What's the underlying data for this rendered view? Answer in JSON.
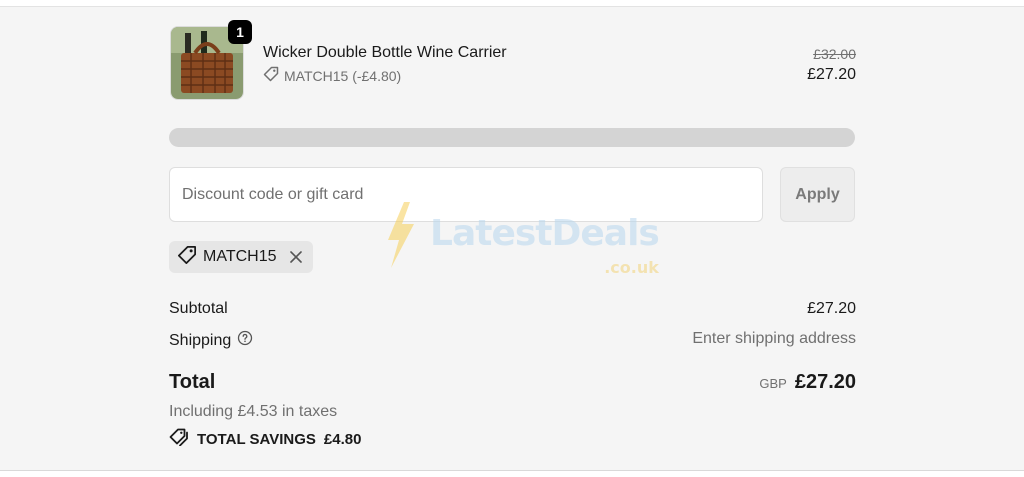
{
  "product": {
    "quantity": "1",
    "name": "Wicker Double Bottle Wine Carrier",
    "discount_text": "MATCH15 (-£4.80)",
    "original_price": "£32.00",
    "price": "£27.20"
  },
  "discount": {
    "placeholder": "Discount code or gift card",
    "apply_label": "Apply",
    "applied_code": "MATCH15"
  },
  "watermark": {
    "name": "LatestDeals",
    "suffix": ".co.uk"
  },
  "summary": {
    "subtotal_label": "Subtotal",
    "subtotal_value": "£27.20",
    "shipping_label": "Shipping",
    "shipping_value": "Enter shipping address",
    "total_label": "Total",
    "currency": "GBP",
    "total_value": "£27.20",
    "tax_note": "Including £4.53 in taxes",
    "savings_label": "TOTAL SAVINGS",
    "savings_value": "£4.80"
  },
  "colors": {
    "panel_bg": "#f5f5f5",
    "muted_text": "#707070",
    "chip_bg": "#e6e6e6"
  }
}
